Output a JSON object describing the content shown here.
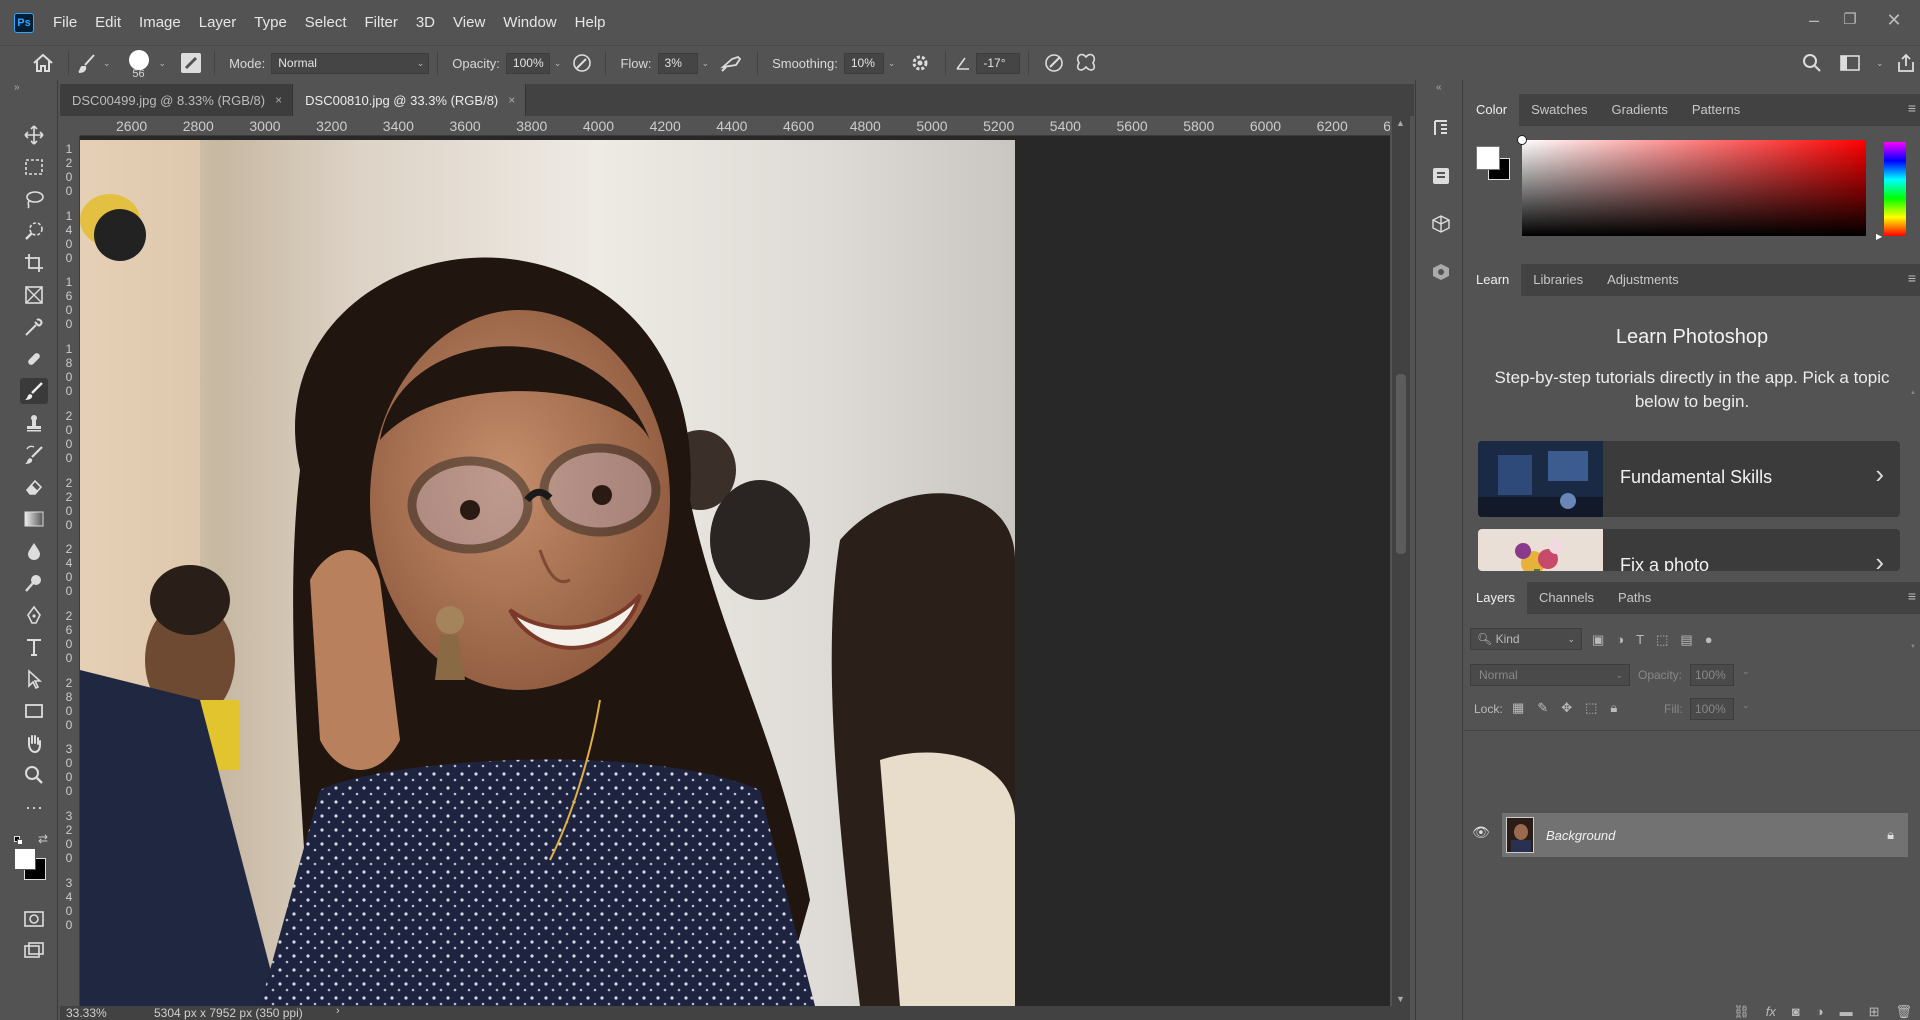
{
  "app": {
    "logo": "Ps"
  },
  "menu": [
    "File",
    "Edit",
    "Image",
    "Layer",
    "Type",
    "Select",
    "Filter",
    "3D",
    "View",
    "Window",
    "Help"
  ],
  "options": {
    "brush_size": "56",
    "mode_label": "Mode:",
    "mode_value": "Normal",
    "opacity_label": "Opacity:",
    "opacity_value": "100%",
    "flow_label": "Flow:",
    "flow_value": "3%",
    "smoothing_label": "Smoothing:",
    "smoothing_value": "10%",
    "angle_value": "-17°"
  },
  "tabs": [
    {
      "label": "DSC00499.jpg @ 8.33% (RGB/8)",
      "close": "×"
    },
    {
      "label": "DSC00810.jpg @ 33.3% (RGB/8)",
      "close": "×"
    }
  ],
  "ruler": {
    "h_ticks": [
      "2600",
      "2800",
      "3000",
      "3200",
      "3400",
      "3600",
      "3800",
      "4000",
      "4200",
      "4400",
      "4600",
      "4800",
      "5000",
      "5200",
      "5400",
      "5600",
      "5800",
      "6000",
      "6200",
      "6"
    ],
    "v_ticks": [
      "1 2 0 0",
      "1 4 0 0",
      "1 6 0 0",
      "1 8 0 0",
      "2 0 0 0",
      "2 2 0 0",
      "2 4 0 0",
      "2 6 0 0",
      "2 8 0 0",
      "3 0 0 0",
      "3 2 0 0",
      "3 4 0 0"
    ]
  },
  "status": {
    "zoom": "33.33%",
    "doc_info": "5304 px x 7952 px (350 ppi)"
  },
  "color_panel": {
    "tabs": [
      "Color",
      "Swatches",
      "Gradients",
      "Patterns"
    ]
  },
  "learn_panel": {
    "tabs": [
      "Learn",
      "Libraries",
      "Adjustments"
    ],
    "title": "Learn Photoshop",
    "description": "Step-by-step tutorials directly in the app. Pick a topic below to begin.",
    "cards": [
      {
        "title": "Fundamental Skills",
        "chevron": "›"
      },
      {
        "title": "Fix a photo",
        "chevron": "›"
      }
    ]
  },
  "layers_panel": {
    "tabs": [
      "Layers",
      "Channels",
      "Paths"
    ],
    "kind": "Kind",
    "blend_mode": "Normal",
    "opacity_label": "Opacity:",
    "opacity_value": "100%",
    "lock_label": "Lock:",
    "fill_label": "Fill:",
    "fill_value": "100%",
    "layers": [
      {
        "name": "Background"
      }
    ]
  },
  "colors": {
    "accent": "#31a8ff",
    "panel_bg": "#535353",
    "canvas_bg": "#282828"
  }
}
